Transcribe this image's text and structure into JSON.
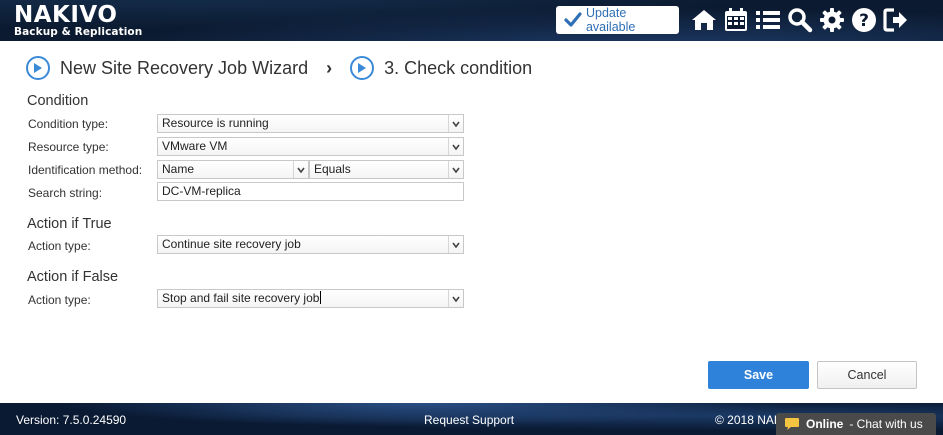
{
  "header": {
    "logo_main": "NAKIVO",
    "logo_sub": "Backup & Replication",
    "update_label": "Update available",
    "icons": [
      "home-icon",
      "calendar-icon",
      "list-icon",
      "search-icon",
      "gear-icon",
      "help-icon",
      "logout-icon"
    ]
  },
  "wizard": {
    "title": "New Site Recovery Job Wizard",
    "step": "3. Check condition"
  },
  "condition": {
    "heading": "Condition",
    "condition_type_label": "Condition type:",
    "condition_type_value": "Resource is running",
    "resource_type_label": "Resource type:",
    "resource_type_value": "VMware VM",
    "identification_label": "Identification method:",
    "identification_value": "Name",
    "match_value": "Equals",
    "search_label": "Search string:",
    "search_value": "DC-VM-replica"
  },
  "action_true": {
    "heading": "Action if True",
    "label": "Action type:",
    "value": "Continue site recovery job"
  },
  "action_false": {
    "heading": "Action if False",
    "label": "Action type:",
    "value": "Stop and fail site recovery job"
  },
  "buttons": {
    "save": "Save",
    "cancel": "Cancel"
  },
  "footer": {
    "version": "Version: 7.5.0.24590",
    "request_support": "Request Support",
    "copyright": "© 2018 NAK",
    "chat_status": "Online",
    "chat_text": "- Chat with us"
  },
  "colors": {
    "accent": "#2e82d9",
    "header_bg": "#0b1a30"
  }
}
